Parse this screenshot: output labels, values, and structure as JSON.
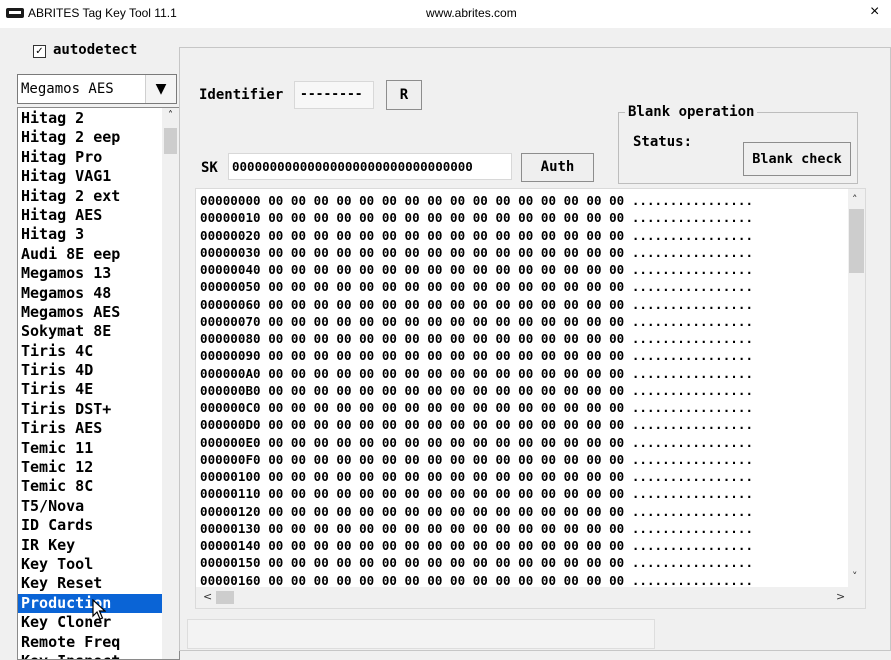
{
  "window": {
    "title": "ABRITES Tag Key Tool 11.1",
    "url": "www.abrites.com",
    "close_label": "×"
  },
  "autodetect": {
    "label": "autodetect",
    "checked": true,
    "check_glyph": "✓"
  },
  "transponder_select": {
    "value": "Megamos AES",
    "arrow": "▼"
  },
  "transponder_list": {
    "items": [
      "Hitag 2",
      "Hitag 2 eep",
      "Hitag Pro",
      "Hitag VAG1",
      "Hitag 2 ext",
      "Hitag AES",
      "Hitag 3",
      "Audi 8E eep",
      "Megamos 13",
      "Megamos 48",
      "Megamos AES",
      "Sokymat 8E",
      "Tiris 4C",
      "Tiris 4D",
      "Tiris 4E",
      "Tiris DST+",
      "Tiris AES",
      "Temic 11",
      "Temic 12",
      "Temic 8C",
      "T5/Nova",
      "ID Cards",
      "IR Key",
      "Key Tool",
      "Key Reset",
      "Production",
      "Key Cloner",
      "Remote Freq",
      "Key Inspect"
    ],
    "selected": "Production",
    "scroll_up": "˄"
  },
  "identifier": {
    "label": "Identifier",
    "value": "--------",
    "read_button": "R"
  },
  "sk": {
    "label": "SK",
    "value": "00000000000000000000000000000000",
    "auth_button": "Auth"
  },
  "blank_operation": {
    "title": "Blank operation",
    "status_label": "Status:",
    "blank_check_button": "Blank check"
  },
  "hex_dump": {
    "addresses": [
      "00000000",
      "00000010",
      "00000020",
      "00000030",
      "00000040",
      "00000050",
      "00000060",
      "00000070",
      "00000080",
      "00000090",
      "000000A0",
      "000000B0",
      "000000C0",
      "000000D0",
      "000000E0",
      "000000F0",
      "00000100",
      "00000110",
      "00000120",
      "00000130",
      "00000140",
      "00000150",
      "00000160"
    ],
    "bytes": "00 00 00 00 00 00 00 00 00 00 00 00 00 00 00 00",
    "ascii": "................",
    "scroll_up": "˄",
    "scroll_down": "˅",
    "scroll_left": "<",
    "scroll_right": ">"
  },
  "status_bar": {
    "text": ""
  }
}
